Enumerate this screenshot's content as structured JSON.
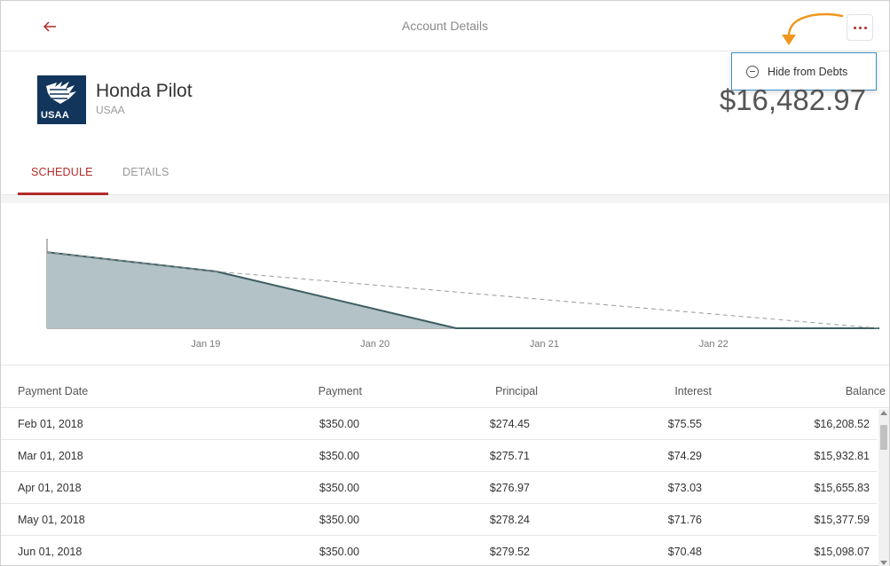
{
  "header": {
    "title": "Account Details",
    "back_icon": "arrow-left-icon",
    "more_icon": "more-dots-icon"
  },
  "menu": {
    "items": [
      {
        "label": "Hide from Debts",
        "icon": "minus-circle-icon"
      }
    ]
  },
  "account": {
    "name": "Honda Pilot",
    "institution": "USAA",
    "logo_text": "USAA",
    "balance": "$16,482.97"
  },
  "tabs": [
    {
      "label": "SCHEDULE",
      "active": true
    },
    {
      "label": "DETAILS",
      "active": false
    }
  ],
  "colors": {
    "accent": "#b42b2b",
    "chart_fill": "#b3c2c6",
    "chart_line": "#3d5e61",
    "annotation": "#f0961e",
    "logo_bg": "#12355b"
  },
  "chart_data": {
    "type": "area",
    "x_tick_labels": [
      "Jan 19",
      "Jan 20",
      "Jan 21",
      "Jan 22"
    ],
    "series": [
      {
        "style": "solid-area",
        "points": [
          {
            "x": "Feb 2018",
            "y": 16482.97
          },
          {
            "x": "Feb 2019",
            "y": 12300
          },
          {
            "x": "Jul 2020",
            "y": 0
          },
          {
            "x": "Jan 2023",
            "y": 0
          }
        ]
      },
      {
        "style": "dashed",
        "points": [
          {
            "x": "Feb 2018",
            "y": 16482.97
          },
          {
            "x": "Feb 2019",
            "y": 12300
          },
          {
            "x": "Jan 2023",
            "y": 0
          }
        ]
      }
    ],
    "ylim": [
      0,
      17500
    ],
    "grid": false
  },
  "table": {
    "columns": [
      "Payment Date",
      "Payment",
      "Principal",
      "Interest",
      "Balance"
    ],
    "rows": [
      [
        "Feb 01, 2018",
        "$350.00",
        "$274.45",
        "$75.55",
        "$16,208.52"
      ],
      [
        "Mar 01, 2018",
        "$350.00",
        "$275.71",
        "$74.29",
        "$15,932.81"
      ],
      [
        "Apr 01, 2018",
        "$350.00",
        "$276.97",
        "$73.03",
        "$15,655.83"
      ],
      [
        "May 01, 2018",
        "$350.00",
        "$278.24",
        "$71.76",
        "$15,377.59"
      ],
      [
        "Jun 01, 2018",
        "$350.00",
        "$279.52",
        "$70.48",
        "$15,098.07"
      ]
    ]
  }
}
